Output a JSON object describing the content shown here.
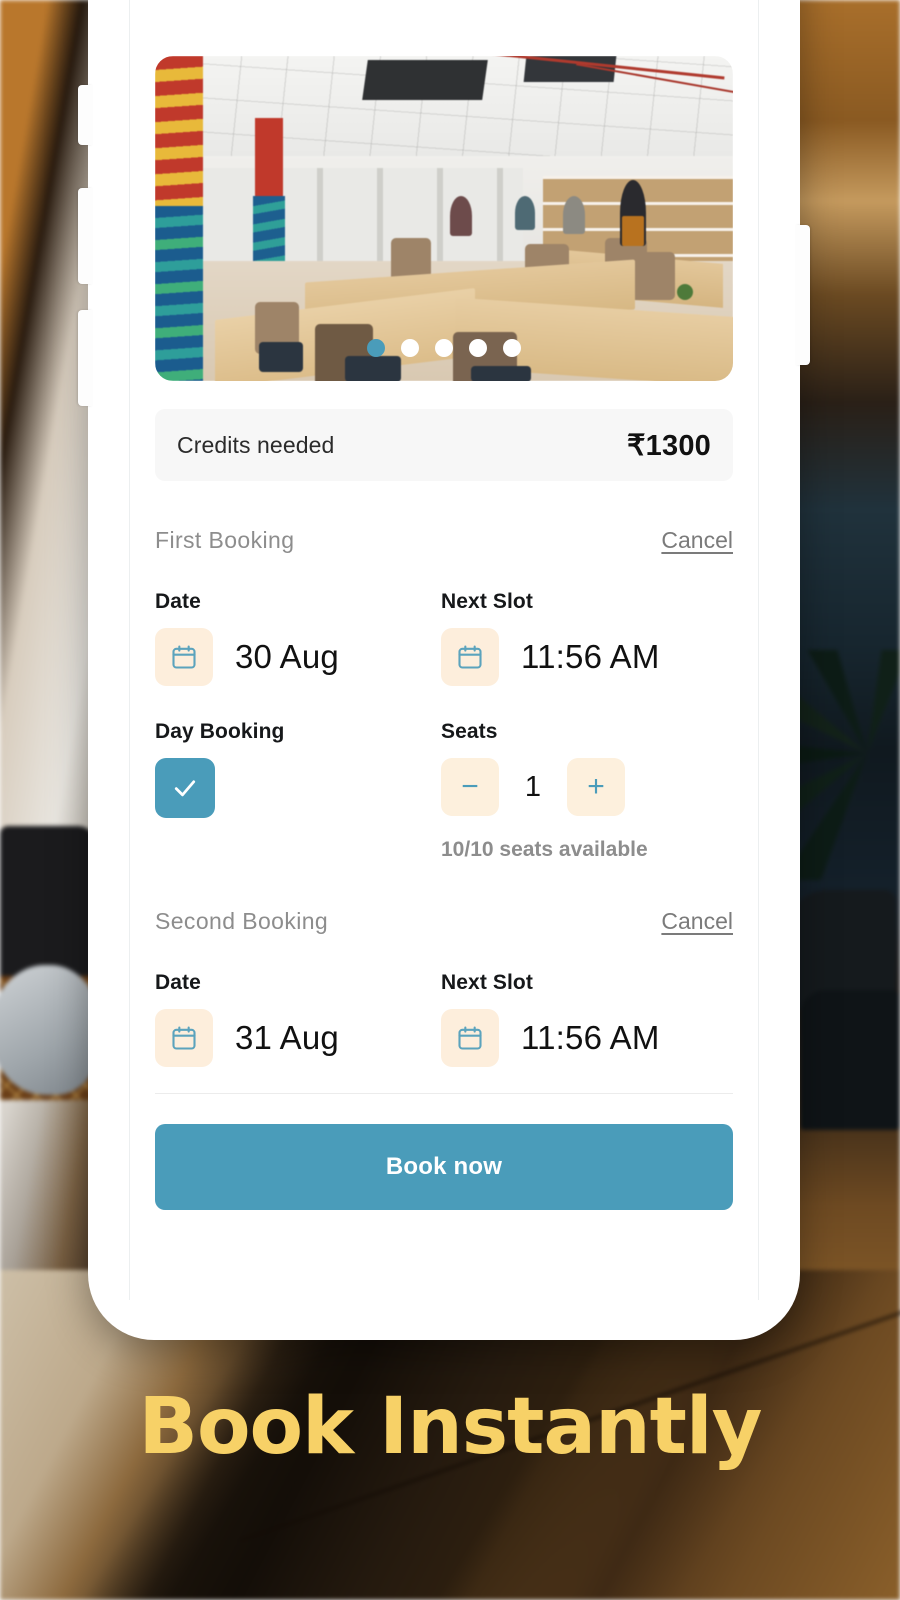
{
  "headline": "Book Instantly",
  "phone": {
    "carousel": {
      "name": "coworking-space-photo",
      "dots_total": 5,
      "active_dot": 1
    },
    "credits": {
      "label": "Credits needed",
      "value": "₹1300"
    },
    "bookings": [
      {
        "title": "First  Booking",
        "cancel_label": "Cancel",
        "date_label": "Date",
        "date_value": "30 Aug",
        "slot_label": "Next Slot",
        "slot_value": "11:56 AM",
        "day_booking_label": "Day Booking",
        "day_booking_checked": true,
        "seats_label": "Seats",
        "seats_value": "1",
        "seats_minus": "−",
        "seats_plus": "+",
        "seats_note": "10/10 seats available"
      },
      {
        "title": "Second  Booking",
        "cancel_label": "Cancel",
        "date_label": "Date",
        "date_value": "31 Aug",
        "slot_label": "Next Slot",
        "slot_value": "11:56 AM"
      }
    ],
    "book_button": "Book now"
  },
  "colors": {
    "accent_teal": "#4A9CBA",
    "icon_box_cream": "#FDEEDC",
    "credits_bg": "#F7F7F7",
    "headline_gold": "#F7D167"
  }
}
